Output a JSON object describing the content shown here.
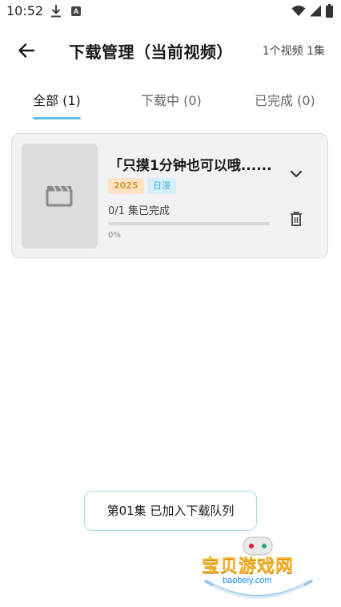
{
  "status_bar": {
    "time": "10:52",
    "download_badge": "A"
  },
  "header": {
    "title": "下载管理（当前视频）",
    "counter": "1个视频 1集"
  },
  "tabs": [
    {
      "label": "全部 (1)",
      "active": true
    },
    {
      "label": "下载中 (0)",
      "active": false
    },
    {
      "label": "已完成 (0)",
      "active": false
    }
  ],
  "download_item": {
    "title": "「只摸1分钟也可以哦......",
    "year_tag": "2025",
    "region_tag": "日漫",
    "progress_text": "0/1 集已完成",
    "progress_value": 0,
    "progress_percent": "0%"
  },
  "toast": {
    "message": "第01集 已加入下载队列"
  },
  "watermark": {
    "text": "宝贝游戏网",
    "url": "baobeiy.com"
  },
  "colors": {
    "accent": "#5bc2ea",
    "year_tag_bg": "#fbe4c5",
    "year_tag_text": "#d89b3c",
    "region_tag_bg": "#d6eefa",
    "region_tag_text": "#47aedc"
  }
}
